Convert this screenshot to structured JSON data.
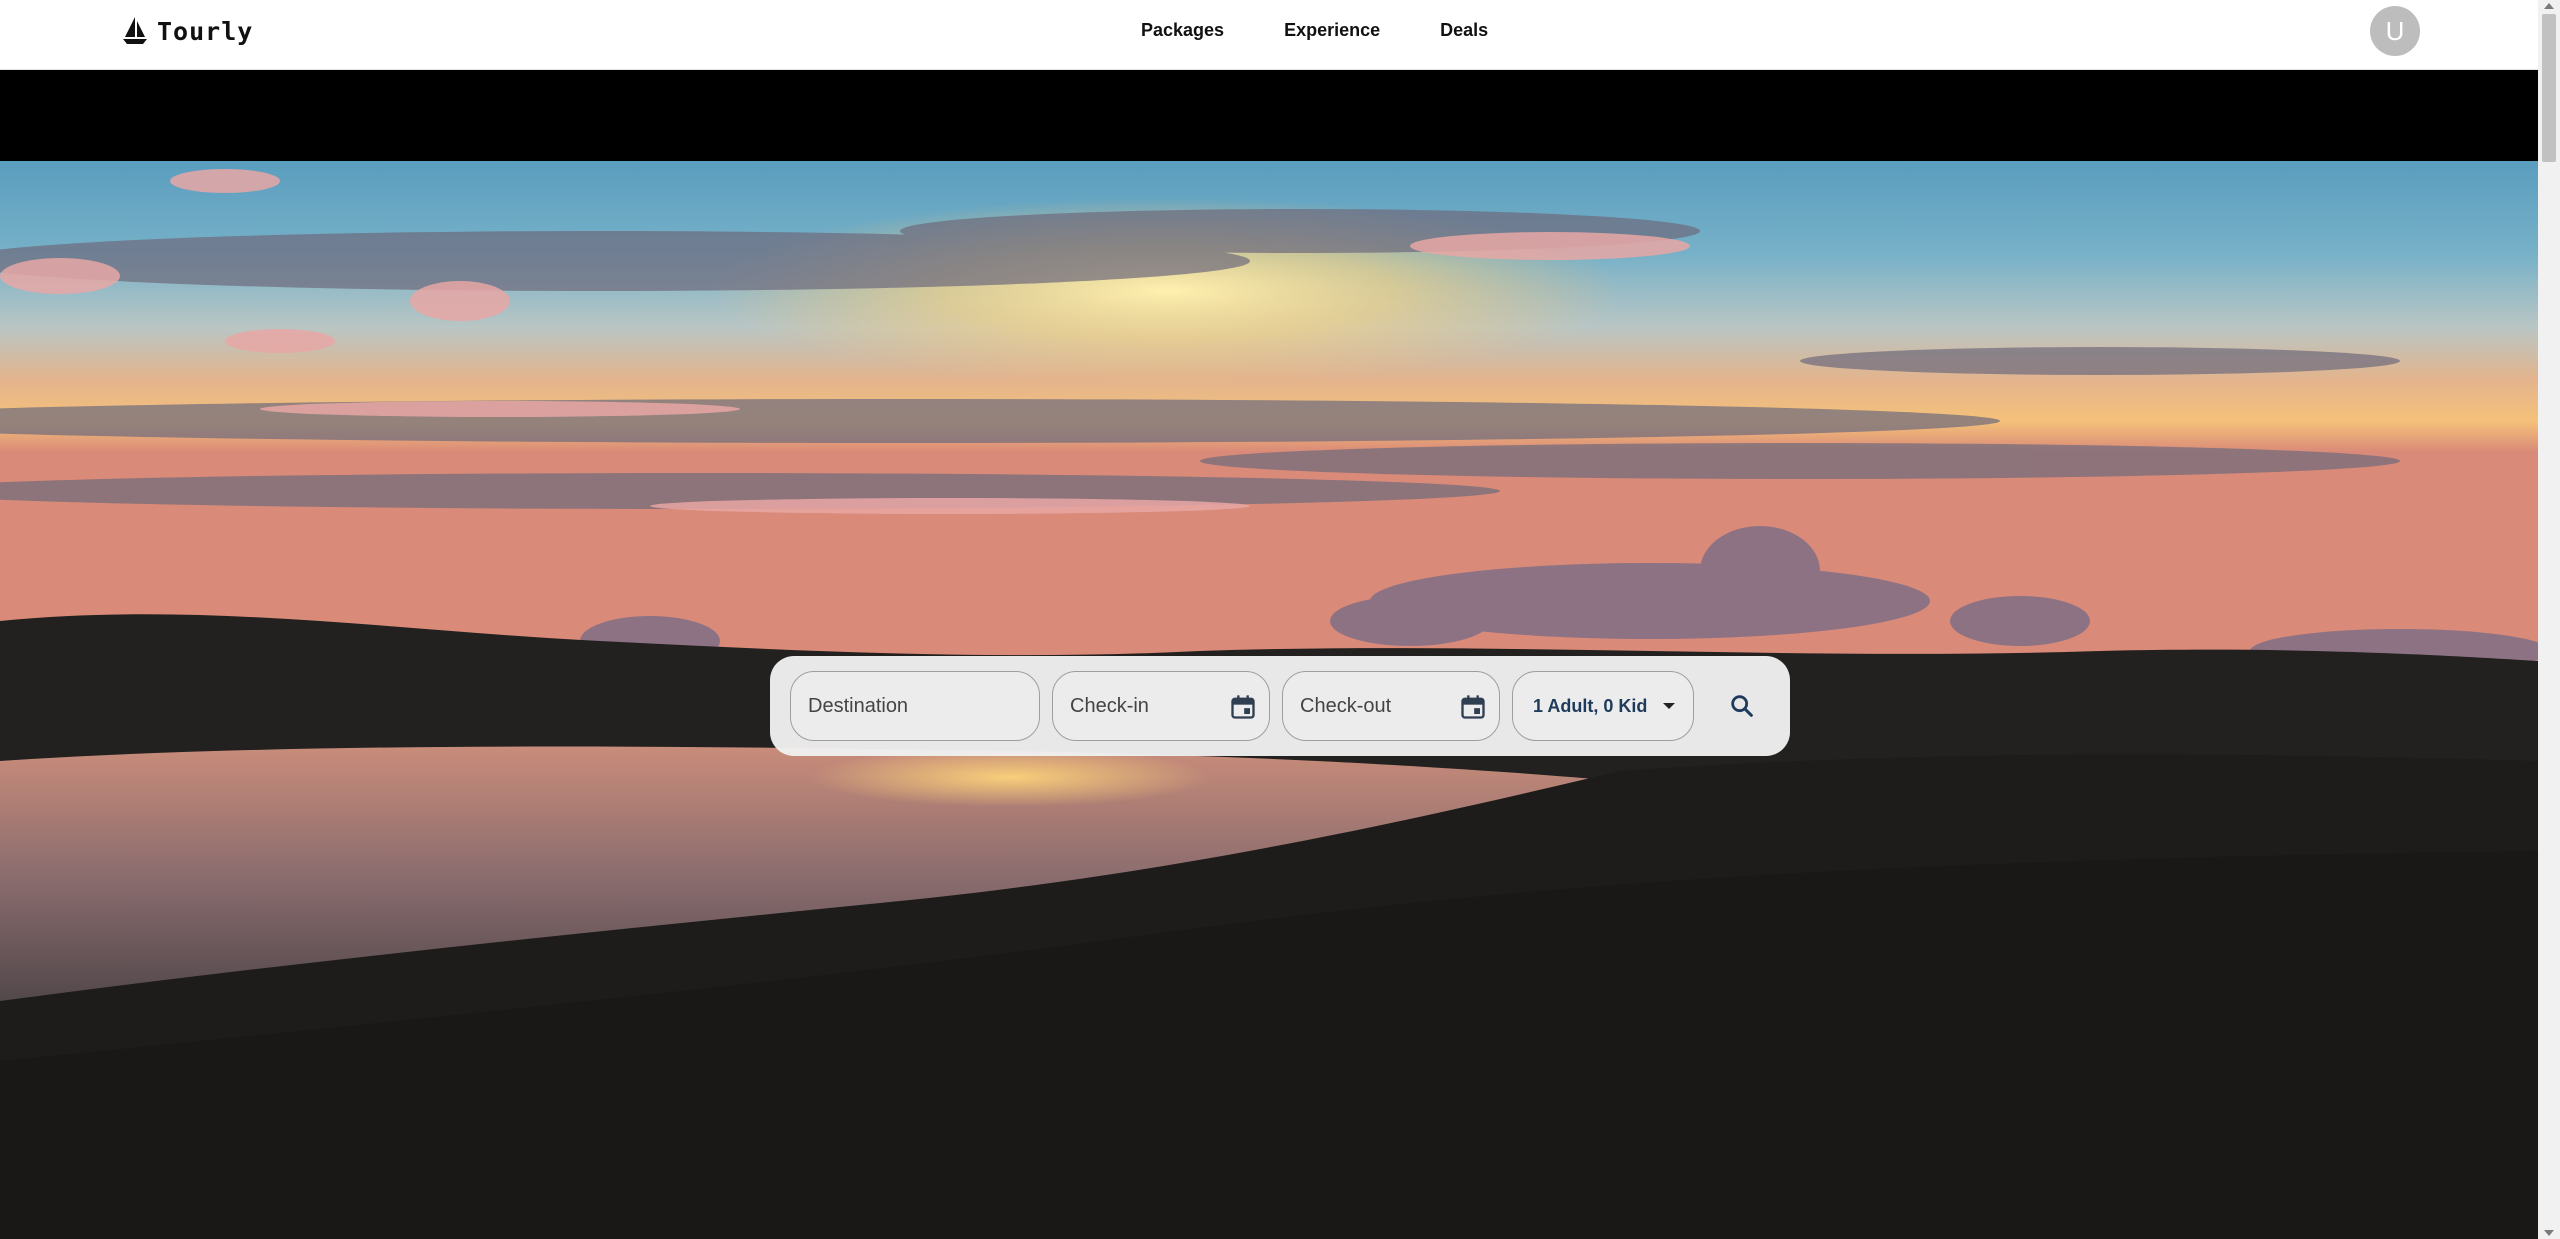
{
  "brand": {
    "name": "Tourly",
    "icon": "sailboat-icon"
  },
  "nav": {
    "items": [
      {
        "label": "Packages"
      },
      {
        "label": "Experience"
      },
      {
        "label": "Deals"
      }
    ]
  },
  "user": {
    "avatar_initial": "U",
    "avatar_color": "#bdbdbd"
  },
  "search": {
    "destination_placeholder": "Destination",
    "checkin_placeholder": "Check-in",
    "checkout_placeholder": "Check-out",
    "guests_value": "1 Adult, 0 Kid",
    "calendar_icon": "calendar-icon",
    "search_icon": "search-icon"
  },
  "colors": {
    "accent_text": "#1f3b5c",
    "header_bg": "#ffffff"
  }
}
